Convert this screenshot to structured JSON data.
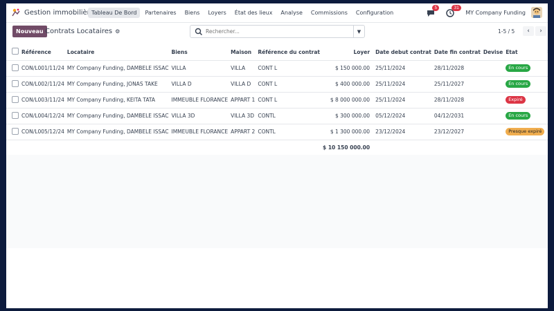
{
  "navbar": {
    "app_title": "Gestion immobilière",
    "menu": [
      {
        "label": "Tableau De Bord",
        "active": true
      },
      {
        "label": "Partenaires"
      },
      {
        "label": "Biens"
      },
      {
        "label": "Loyers"
      },
      {
        "label": "État des lieux"
      },
      {
        "label": "Analyse"
      },
      {
        "label": "Commissions"
      },
      {
        "label": "Configuration"
      }
    ],
    "messages_count": "5",
    "activities_count": "31",
    "company": "MY Company Funding"
  },
  "control": {
    "new_button": "Nouveau",
    "breadcrumb": "Contrats Locataires",
    "search_placeholder": "Rechercher...",
    "pager": "1-5 / 5"
  },
  "table": {
    "headers": [
      "Référence",
      "Locataire",
      "Biens",
      "Maison",
      "Référence du contrat",
      "Loyer",
      "Date debut contrat",
      "Date fin contrat",
      "Devise",
      "Etat"
    ],
    "rows": [
      {
        "ref": "CON/L001/11/24",
        "tenant": "MY Company Funding, DAMBELE ISSAC",
        "property": "VILLA",
        "house": "VILLA",
        "contract_ref": "CONT L",
        "rent": "$ 150 000.00",
        "start": "25/11/2024",
        "end": "28/11/2028",
        "currency": "",
        "status": "En cours",
        "status_color": "#28a745"
      },
      {
        "ref": "CON/L002/11/24",
        "tenant": "MY Company Funding, JONAS TAKE",
        "property": "VILLA D",
        "house": "VILLA D",
        "contract_ref": "CONT L",
        "rent": "$ 400 000.00",
        "start": "25/11/2024",
        "end": "25/11/2027",
        "currency": "",
        "status": "En cours",
        "status_color": "#28a745"
      },
      {
        "ref": "CON/L003/11/24",
        "tenant": "MY Company Funding, KEITA TATA",
        "property": "IMMEUBLE FLORANCE",
        "house": "APPART 1",
        "contract_ref": "CONT L",
        "rent": "$ 8 000 000.00",
        "start": "25/11/2024",
        "end": "28/11/2028",
        "currency": "",
        "status": "Expiré",
        "status_color": "#dc3545"
      },
      {
        "ref": "CON/L004/12/24",
        "tenant": "MY Company Funding, DAMBELE ISSAC",
        "property": "VILLA 3D",
        "house": "VILLA 3D",
        "contract_ref": "CONTL",
        "rent": "$ 300 000.00",
        "start": "05/12/2024",
        "end": "04/12/2031",
        "currency": "",
        "status": "En cours",
        "status_color": "#28a745"
      },
      {
        "ref": "CON/L005/12/24",
        "tenant": "MY Company Funding, DAMBELE ISSAC",
        "property": "IMMEUBLE FLORANCE",
        "house": "APPART 2",
        "contract_ref": "CONTL",
        "rent": "$ 1 300 000.00",
        "start": "23/12/2024",
        "end": "23/12/2027",
        "currency": "",
        "status": "Presque expiré",
        "status_color": "#f0ad4e"
      }
    ],
    "total_rent": "$ 10 150 000.00"
  },
  "colors": {
    "brand": "#714b67",
    "en_cours": "#28a745",
    "expire": "#dc3545",
    "presque_expire": "#f0ad4e"
  }
}
